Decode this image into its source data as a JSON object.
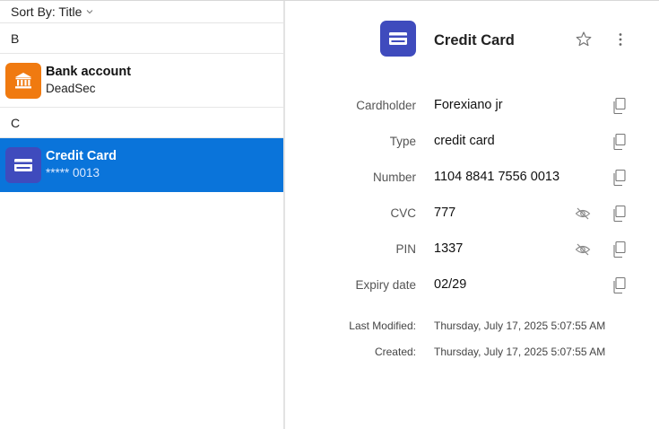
{
  "sort": {
    "label": "Sort By: Title"
  },
  "groups": [
    {
      "letter": "B",
      "entries": [
        {
          "title": "Bank account",
          "subtitle": "DeadSec",
          "icon": "bank-icon",
          "color": "#f07a10"
        }
      ]
    },
    {
      "letter": "C",
      "entries": [
        {
          "title": "Credit Card",
          "subtitle": "***** 0013",
          "icon": "credit-card-icon",
          "color": "#3f4bbd",
          "selected": true
        }
      ]
    }
  ],
  "detail": {
    "title": "Credit Card",
    "icon": "credit-card-icon",
    "fields": [
      {
        "label": "Cardholder",
        "value": "Forexiano jr"
      },
      {
        "label": "Type",
        "value": "credit card"
      },
      {
        "label": "Number",
        "value": "1104 8841 7556 0013"
      },
      {
        "label": "CVC",
        "value": "777",
        "concealable": true
      },
      {
        "label": "PIN",
        "value": "1337",
        "concealable": true
      },
      {
        "label": "Expiry date",
        "value": "02/29"
      }
    ],
    "meta": {
      "last_modified_label": "Last Modified:",
      "last_modified_value": "Thursday, July 17, 2025 5:07:55 AM",
      "created_label": "Created:",
      "created_value": "Thursday, July 17, 2025 5:07:55 AM"
    }
  },
  "colors": {
    "accent": "#0a74da",
    "orange": "#f07a10",
    "indigo": "#3f4bbd"
  }
}
